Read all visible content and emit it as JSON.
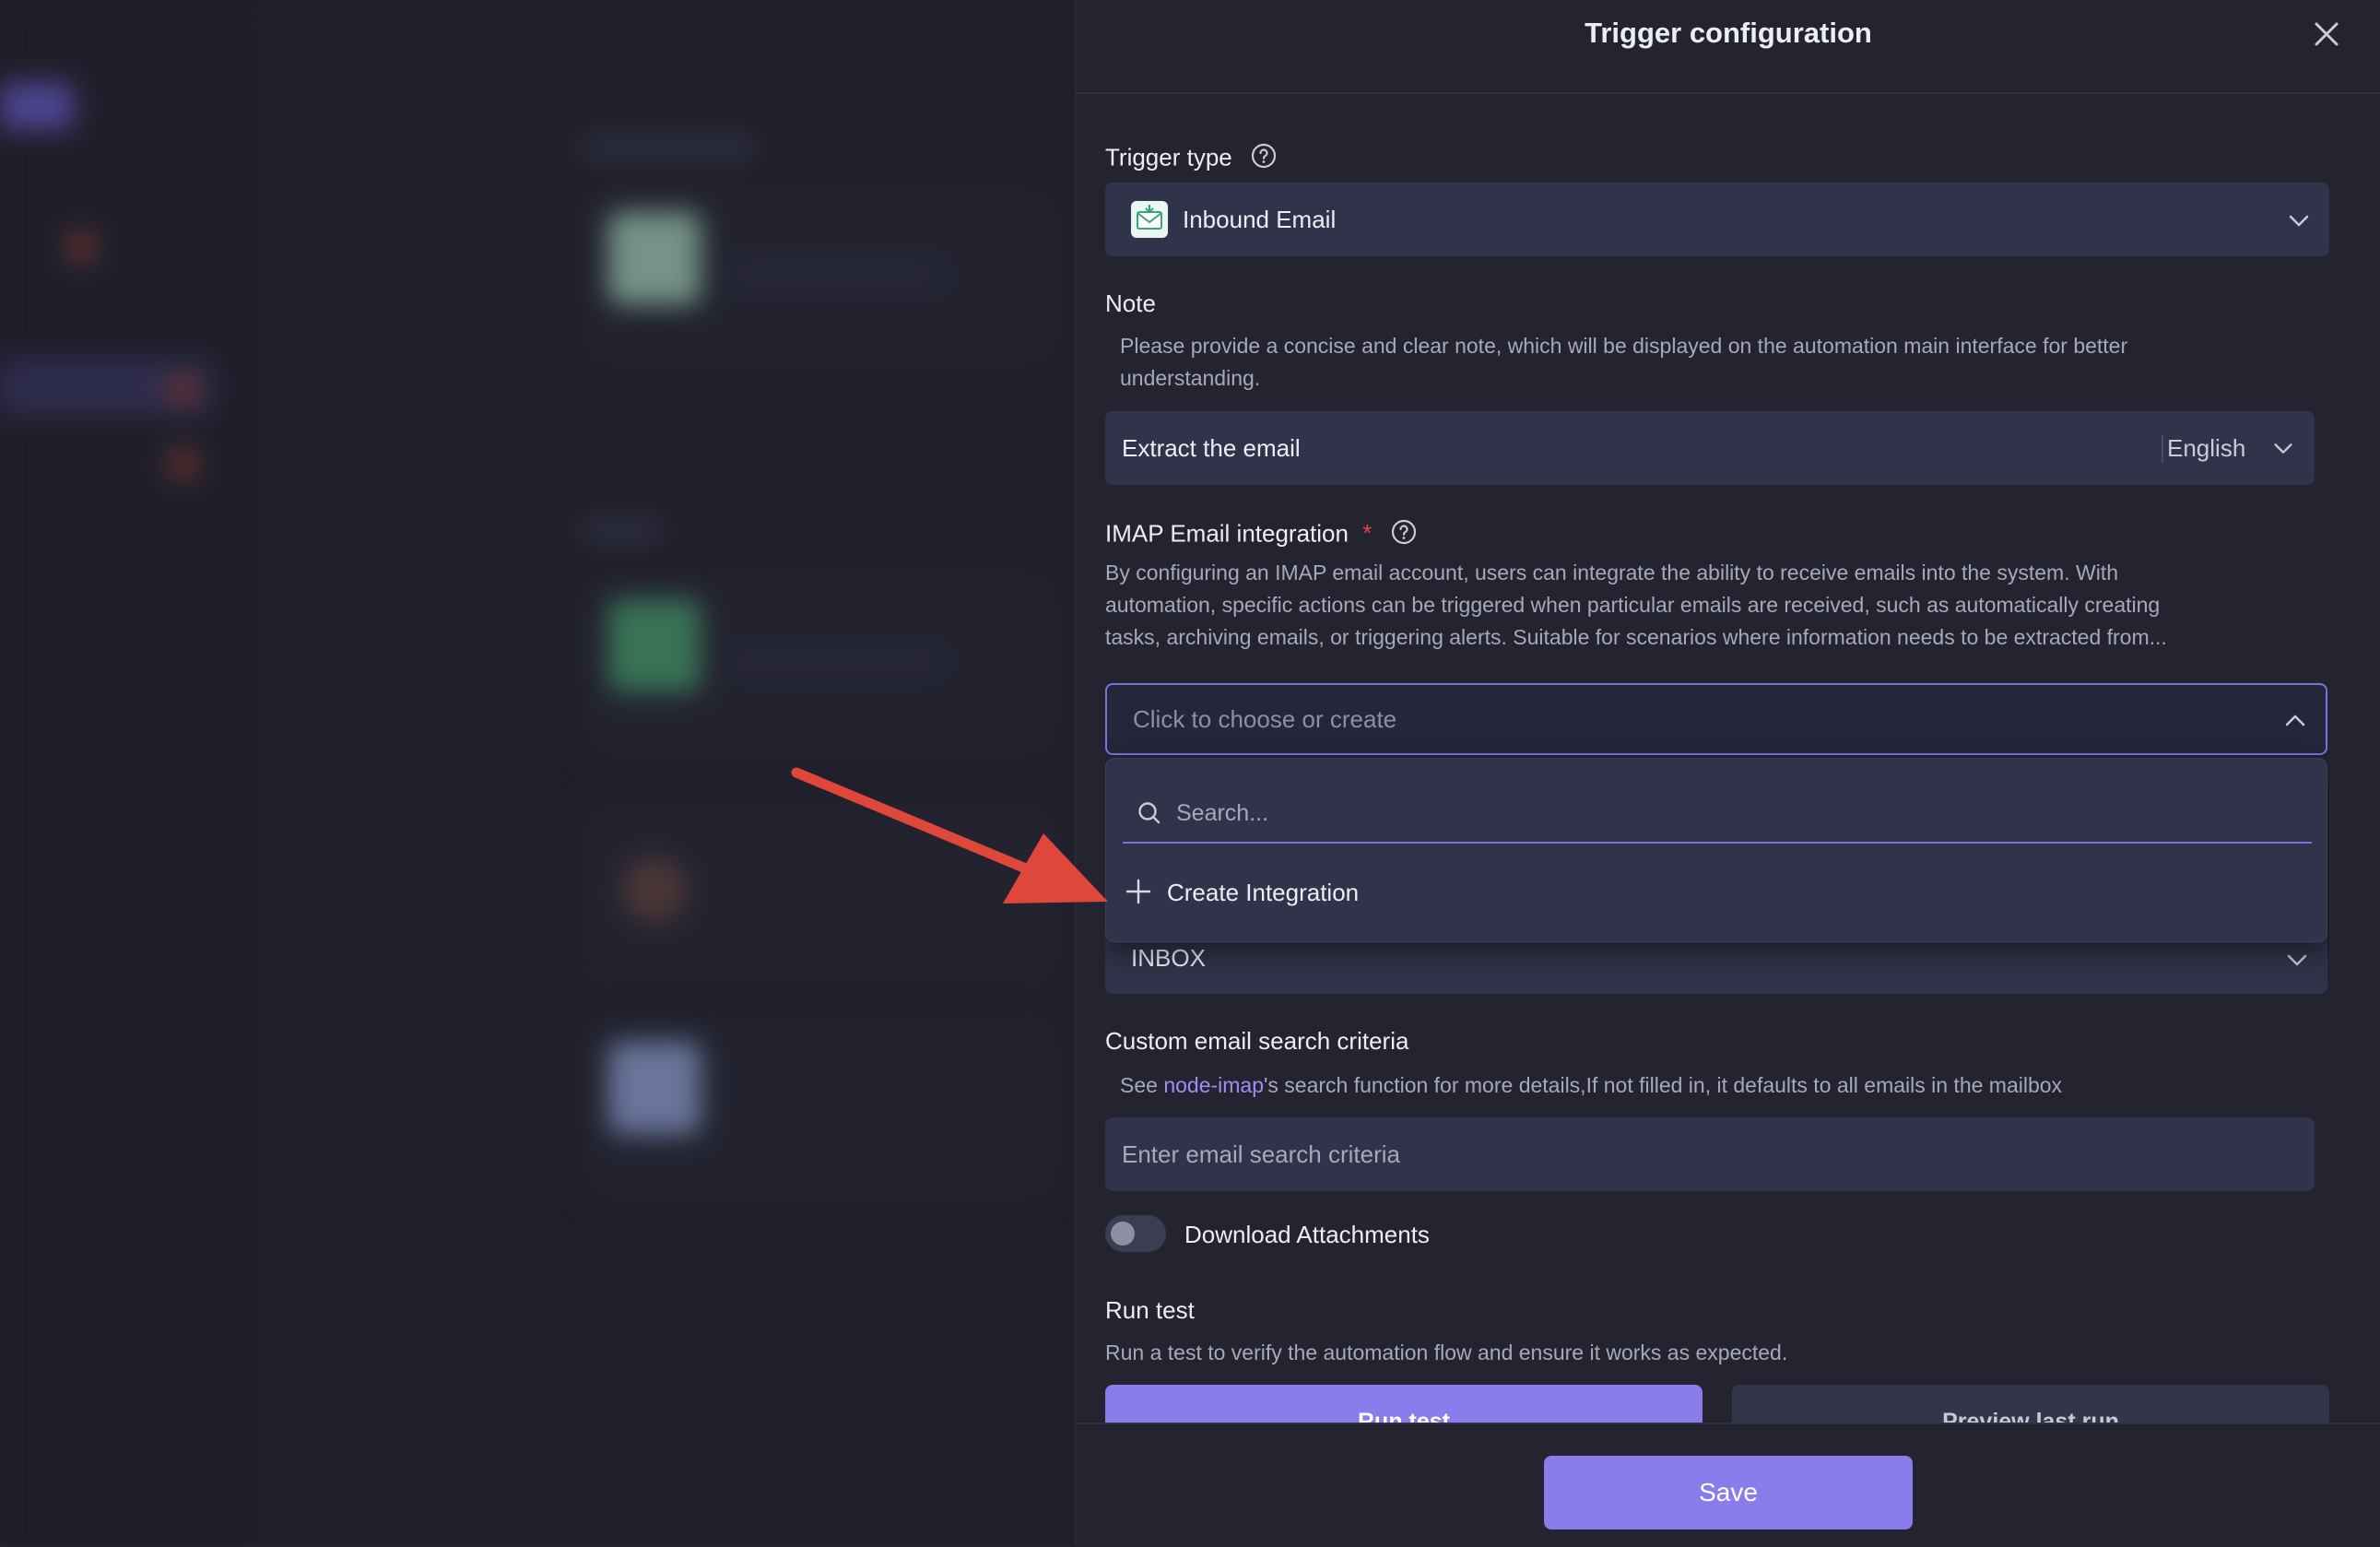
{
  "drawer": {
    "title": "Trigger configuration",
    "close_icon": "close-icon"
  },
  "trigger_type": {
    "label": "Trigger type",
    "help_icon": "question-circle-icon",
    "value": "Inbound Email",
    "icon": "inbound-email-icon"
  },
  "note": {
    "label": "Note",
    "description_1": "Please provide a concise and clear note, which will be displayed on the automation main interface for better",
    "description_2": "understanding.",
    "value": "Extract the email",
    "language": "English"
  },
  "imap": {
    "label": "IMAP Email integration",
    "required_mark": "*",
    "help_icon": "question-circle-icon",
    "description_1": "By configuring an IMAP email account, users can integrate the ability to receive emails into the system. With",
    "description_2": "automation, specific actions can be triggered when particular emails are received, such as automatically creating",
    "description_3": "tasks, archiving emails, or triggering alerts. Suitable for scenarios where information needs to be extracted from...",
    "placeholder": "Click to choose or create",
    "dropdown": {
      "search_placeholder": "Search...",
      "create_label": "Create Integration"
    }
  },
  "mailbox": {
    "value": "INBOX"
  },
  "criteria": {
    "label": "Custom email search criteria",
    "desc_prefix": "See ",
    "desc_link": "node-imap",
    "desc_suffix": "'s search function for more details,If not filled in, it defaults to all emails in the mailbox",
    "placeholder": "Enter email search criteria"
  },
  "attachments": {
    "label": "Download Attachments",
    "enabled": false
  },
  "run_test": {
    "label": "Run test",
    "description": "Run a test to verify the automation flow and ensure it works as expected.",
    "run_button": "Run test",
    "preview_button": "Preview last run"
  },
  "footer": {
    "save_label": "Save"
  },
  "colors": {
    "accent": "#8a7ceb",
    "annotation_arrow": "#e0473b"
  }
}
